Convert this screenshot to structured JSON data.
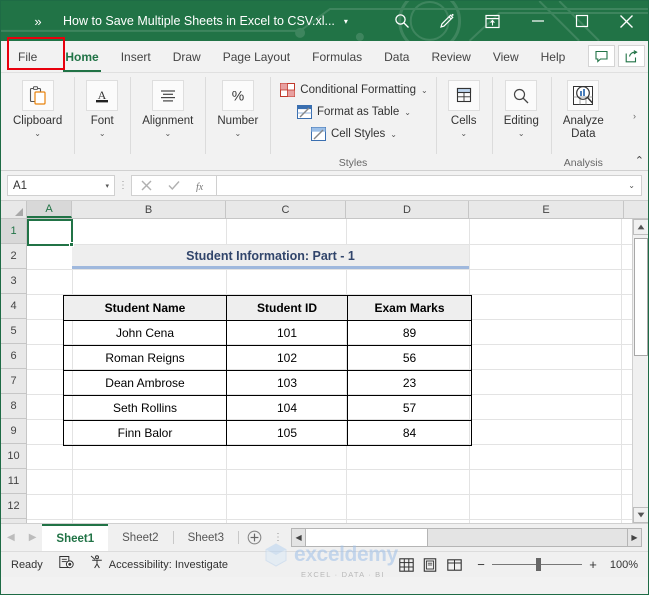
{
  "titlebar": {
    "chevron": "»",
    "title": "How to Save Multiple Sheets in Excel to CSV.xl...",
    "title_dropdown": "▾",
    "search_icon": "search-icon",
    "pen_icon": "pen-icon",
    "ribbon_display_icon": "ribbon-display-options-icon",
    "minimize": "minimize-icon",
    "maximize": "maximize-icon",
    "close": "close-icon",
    "bg_color": "#217346"
  },
  "ribbon_tabs": {
    "items": [
      {
        "label": "File",
        "active": false,
        "highlighted": true
      },
      {
        "label": "Home",
        "active": true,
        "highlighted": false
      },
      {
        "label": "Insert",
        "active": false,
        "highlighted": false
      },
      {
        "label": "Draw",
        "active": false,
        "highlighted": false
      },
      {
        "label": "Page Layout",
        "active": false,
        "highlighted": false
      },
      {
        "label": "Formulas",
        "active": false,
        "highlighted": false
      },
      {
        "label": "Data",
        "active": false,
        "highlighted": false
      },
      {
        "label": "Review",
        "active": false,
        "highlighted": false
      },
      {
        "label": "View",
        "active": false,
        "highlighted": false
      },
      {
        "label": "Help",
        "active": false,
        "highlighted": false
      }
    ],
    "comments_icon": "comment-icon",
    "share_icon": "share-icon",
    "highlight_color": "#e8000d",
    "active_color": "#217346"
  },
  "ribbon": {
    "groups": [
      {
        "label": "Clipboard",
        "icon": "clipboard-icon",
        "caret": "⌄"
      },
      {
        "label": "Font",
        "icon": "font-icon",
        "caret": "⌄"
      },
      {
        "label": "Alignment",
        "icon": "alignment-icon",
        "caret": "⌄"
      },
      {
        "label": "Number",
        "icon": "percent-icon",
        "caret": "⌄"
      }
    ],
    "styles": {
      "group_name": "Styles",
      "items": [
        {
          "label": "Conditional Formatting",
          "icon": "conditional-formatting-icon",
          "caret": "⌄"
        },
        {
          "label": "Format as Table",
          "icon": "format-as-table-icon",
          "caret": "⌄"
        },
        {
          "label": "Cell Styles",
          "icon": "cell-styles-icon",
          "caret": "⌄"
        }
      ]
    },
    "cells": {
      "label": "Cells",
      "icon": "cells-icon",
      "caret": "⌄"
    },
    "editing": {
      "label": "Editing",
      "icon": "editing-search-icon",
      "caret": "⌄"
    },
    "analysis": {
      "group_name": "Analysis",
      "label_line1": "Analyze",
      "label_line2": "Data",
      "icon": "analyze-data-icon"
    },
    "more_caret": "›",
    "collapse_caret": "⌃"
  },
  "formula_bar": {
    "name_box_value": "A1",
    "name_box_dropdown": "▾",
    "cancel_icon": "cancel-x-icon",
    "confirm_icon": "confirm-check-icon",
    "fx_icon": "fx-icon",
    "formula_value": "",
    "expand_dropdown": "⌄"
  },
  "grid": {
    "columns": [
      "A",
      "B",
      "C",
      "D",
      "E"
    ],
    "selected_column": "A",
    "rows": [
      "1",
      "2",
      "3",
      "4",
      "5",
      "6",
      "7",
      "8",
      "9",
      "10",
      "11",
      "12"
    ],
    "selected_row": "1",
    "selected_cell": "A1",
    "sheet_title": "Student Information: Part - 1",
    "sheet_title_color": "#31456b",
    "sheet_title_bg": "#eeeeee",
    "sheet_title_underline": "#9fb8dd",
    "table": {
      "headers": [
        "Student Name",
        "Student ID",
        "Exam Marks"
      ],
      "rows": [
        [
          "John Cena",
          "101",
          "89"
        ],
        [
          "Roman Reigns",
          "102",
          "56"
        ],
        [
          "Dean Ambrose",
          "103",
          "23"
        ],
        [
          "Seth Rollins",
          "104",
          "57"
        ],
        [
          "Finn Balor",
          "105",
          "84"
        ]
      ]
    }
  },
  "sheet_tabs": {
    "prev_icon": "prev-sheet-arrow-icon",
    "next_icon": "next-sheet-arrow-icon",
    "tabs": [
      {
        "label": "Sheet1",
        "active": true
      },
      {
        "label": "Sheet2",
        "active": false
      },
      {
        "label": "Sheet3",
        "active": false
      }
    ],
    "add_sheet_icon": "add-sheet-plus-icon",
    "dots": "⋮",
    "hscroll_left": "◀",
    "hscroll_right": "▶"
  },
  "status_bar": {
    "mode": "Ready",
    "record_macro_icon": "record-macro-icon",
    "accessibility_icon": "accessibility-icon",
    "accessibility_text": "Accessibility: Investigate",
    "views": [
      {
        "name": "normal-view-icon",
        "active": false
      },
      {
        "name": "page-layout-view-icon",
        "active": false
      },
      {
        "name": "page-break-preview-icon",
        "active": false
      }
    ],
    "zoom_out": "−",
    "zoom_in": "+",
    "zoom_level": "100%"
  },
  "watermark": {
    "text": "exceldemy",
    "subtitle": "EXCEL · DATA · BI",
    "color": "#9fc0e8"
  }
}
